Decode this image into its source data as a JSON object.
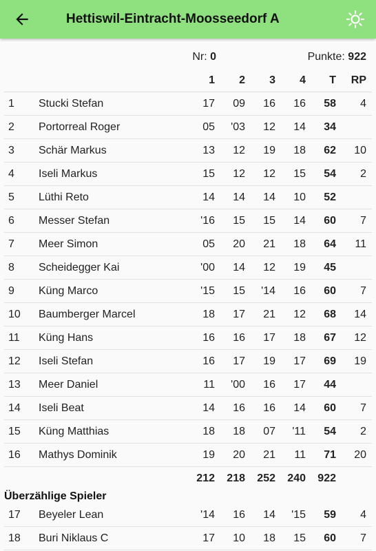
{
  "header": {
    "title": "Hettiswil-Eintracht-Moosseedorf A",
    "accent": "#8fe07f"
  },
  "meta": {
    "nr_label": "Nr:",
    "nr_value": "0",
    "punkte_label": "Punkte:",
    "punkte_value": "922"
  },
  "columns": {
    "s1": "1",
    "s2": "2",
    "s3": "3",
    "s4": "4",
    "total": "T",
    "rp": "RP"
  },
  "players": [
    {
      "rank": "1",
      "name": "Stucki Stefan",
      "s1": "17",
      "s2": "09",
      "s3": "16",
      "s4": "16",
      "t": "58",
      "rp": "4"
    },
    {
      "rank": "2",
      "name": "Portorreal Roger",
      "s1": "05",
      "s2": "'03",
      "s3": "12",
      "s4": "14",
      "t": "34",
      "rp": ""
    },
    {
      "rank": "3",
      "name": "Schär Markus",
      "s1": "13",
      "s2": "12",
      "s3": "19",
      "s4": "18",
      "t": "62",
      "rp": "10"
    },
    {
      "rank": "4",
      "name": "Iseli Markus",
      "s1": "15",
      "s2": "12",
      "s3": "12",
      "s4": "15",
      "t": "54",
      "rp": "2"
    },
    {
      "rank": "5",
      "name": "Lüthi Reto",
      "s1": "14",
      "s2": "14",
      "s3": "14",
      "s4": "10",
      "t": "52",
      "rp": ""
    },
    {
      "rank": "6",
      "name": "Messer Stefan",
      "s1": "'16",
      "s2": "15",
      "s3": "15",
      "s4": "14",
      "t": "60",
      "rp": "7"
    },
    {
      "rank": "7",
      "name": "Meer Simon",
      "s1": "05",
      "s2": "20",
      "s3": "21",
      "s4": "18",
      "t": "64",
      "rp": "11"
    },
    {
      "rank": "8",
      "name": "Scheidegger Kai",
      "s1": "'00",
      "s2": "14",
      "s3": "12",
      "s4": "19",
      "t": "45",
      "rp": ""
    },
    {
      "rank": "9",
      "name": "Küng Marco",
      "s1": "'15",
      "s2": "15",
      "s3": "'14",
      "s4": "16",
      "t": "60",
      "rp": "7"
    },
    {
      "rank": "10",
      "name": "Baumberger Marcel",
      "s1": "18",
      "s2": "17",
      "s3": "21",
      "s4": "12",
      "t": "68",
      "rp": "14"
    },
    {
      "rank": "11",
      "name": "Küng Hans",
      "s1": "16",
      "s2": "16",
      "s3": "17",
      "s4": "18",
      "t": "67",
      "rp": "12"
    },
    {
      "rank": "12",
      "name": "Iseli Stefan",
      "s1": "16",
      "s2": "17",
      "s3": "19",
      "s4": "17",
      "t": "69",
      "rp": "19"
    },
    {
      "rank": "13",
      "name": "Meer Daniel",
      "s1": "11",
      "s2": "'00",
      "s3": "16",
      "s4": "17",
      "t": "44",
      "rp": ""
    },
    {
      "rank": "14",
      "name": "Iseli Beat",
      "s1": "14",
      "s2": "16",
      "s3": "16",
      "s4": "14",
      "t": "60",
      "rp": "7"
    },
    {
      "rank": "15",
      "name": "Küng Matthias",
      "s1": "18",
      "s2": "18",
      "s3": "07",
      "s4": "'11",
      "t": "54",
      "rp": "2"
    },
    {
      "rank": "16",
      "name": "Mathys Dominik",
      "s1": "19",
      "s2": "20",
      "s3": "21",
      "s4": "11",
      "t": "71",
      "rp": "20"
    }
  ],
  "totals": {
    "s1": "212",
    "s2": "218",
    "s3": "252",
    "s4": "240",
    "t": "922"
  },
  "extra_section_label": "Überzählige Spieler",
  "extra_players": [
    {
      "rank": "17",
      "name": "Beyeler Lean",
      "s1": "'14",
      "s2": "16",
      "s3": "14",
      "s4": "'15",
      "t": "59",
      "rp": "4"
    },
    {
      "rank": "18",
      "name": "Buri Niklaus C",
      "s1": "17",
      "s2": "10",
      "s3": "18",
      "s4": "15",
      "t": "60",
      "rp": "7"
    }
  ]
}
